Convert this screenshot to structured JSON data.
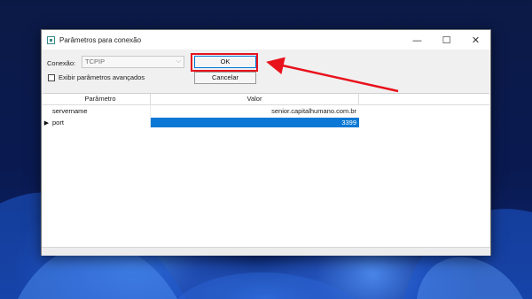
{
  "window": {
    "title": "Parâmetros para conexão",
    "controls": {
      "minimize": "—",
      "maximize": "☐",
      "close": "✕"
    }
  },
  "form": {
    "connection_label": "Conexão:",
    "connection_value": "TCPIP",
    "advanced_label": "Exibir parâmetros avançados",
    "advanced_checked": false,
    "ok_label": "OK",
    "cancel_label": "Cancelar"
  },
  "grid": {
    "columns": [
      "Parâmetro",
      "Valor"
    ],
    "rows": [
      {
        "param": "servername",
        "value": "senior.capitalhumano.com.br",
        "selected": false
      },
      {
        "param": "port",
        "value": "3399",
        "selected": true
      }
    ],
    "row_indicator": "▶"
  },
  "annotation": {
    "highlight_color": "#e8121c",
    "target": "OK"
  },
  "colors": {
    "selection": "#0a78d4",
    "accent": "#0078d7"
  }
}
